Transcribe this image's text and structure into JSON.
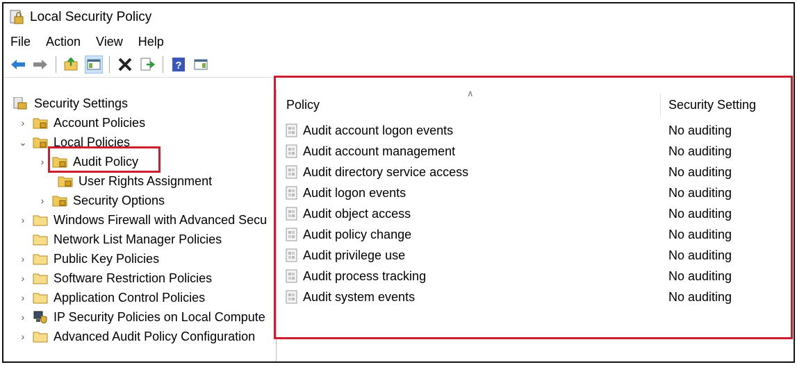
{
  "window": {
    "title": "Local Security Policy"
  },
  "menu": [
    "File",
    "Action",
    "View",
    "Help"
  ],
  "tree": {
    "root": "Security Settings",
    "items": [
      {
        "label": "Account Policies"
      },
      {
        "label": "Local Policies"
      },
      {
        "label": "Audit Policy"
      },
      {
        "label": "User Rights Assignment"
      },
      {
        "label": "Security Options"
      },
      {
        "label": "Windows Firewall with Advanced Secu"
      },
      {
        "label": "Network List Manager Policies"
      },
      {
        "label": "Public Key Policies"
      },
      {
        "label": "Software Restriction Policies"
      },
      {
        "label": "Application Control Policies"
      },
      {
        "label": "IP Security Policies on Local Compute"
      },
      {
        "label": "Advanced Audit Policy Configuration"
      }
    ]
  },
  "list": {
    "columns": {
      "policy": "Policy",
      "setting": "Security Setting"
    },
    "rows": [
      {
        "policy": "Audit account logon events",
        "setting": "No auditing"
      },
      {
        "policy": "Audit account management",
        "setting": "No auditing"
      },
      {
        "policy": "Audit directory service access",
        "setting": "No auditing"
      },
      {
        "policy": "Audit logon events",
        "setting": "No auditing"
      },
      {
        "policy": "Audit object access",
        "setting": "No auditing"
      },
      {
        "policy": "Audit policy change",
        "setting": "No auditing"
      },
      {
        "policy": "Audit privilege use",
        "setting": "No auditing"
      },
      {
        "policy": "Audit process tracking",
        "setting": "No auditing"
      },
      {
        "policy": "Audit system events",
        "setting": "No auditing"
      }
    ]
  },
  "colors": {
    "highlight": "#cc1f2d",
    "folder": "#f0c95a"
  }
}
